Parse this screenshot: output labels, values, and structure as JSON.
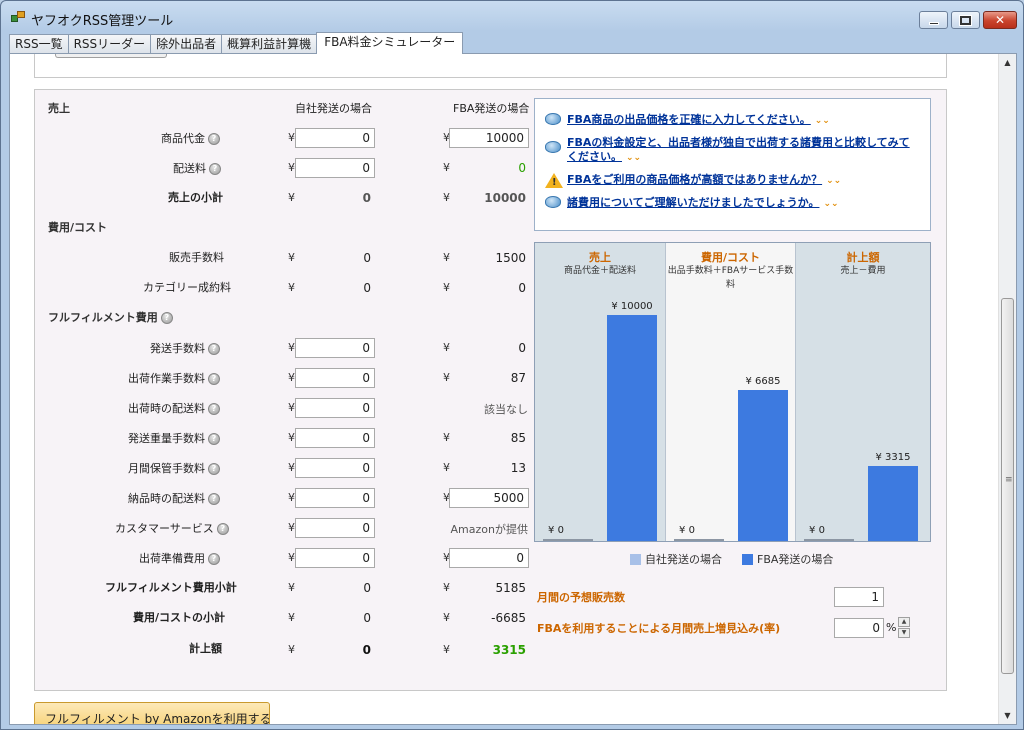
{
  "window": {
    "title": "ヤフオクRSS管理ツール"
  },
  "tabs": [
    {
      "label": "RSS一覧"
    },
    {
      "label": "RSSリーダー"
    },
    {
      "label": "除外出品者"
    },
    {
      "label": "概算利益計算機"
    },
    {
      "label": "FBA料金シミュレーター",
      "active": true
    }
  ],
  "headers": {
    "self": "自社発送の場合",
    "fba": "FBA発送の場合"
  },
  "sections": {
    "sales": "売上",
    "costs": "費用/コスト",
    "fulfillment": "フルフィルメント費用"
  },
  "currency": "¥",
  "rows": {
    "item_price": {
      "label": "商品代金",
      "self": "0",
      "fba": "10000"
    },
    "shipping": {
      "label": "配送料",
      "self": "0",
      "fba": "0"
    },
    "sales_subtotal": {
      "label": "売上の小計",
      "self": "0",
      "fba": "10000"
    },
    "sales_fee": {
      "label": "販売手数料",
      "self": "0",
      "fba": "1500"
    },
    "category_fee": {
      "label": "カテゴリー成約料",
      "self": "0",
      "fba": "0"
    },
    "ship_fee": {
      "label": "発送手数料",
      "self": "0",
      "fba": "0"
    },
    "handling_fee": {
      "label": "出荷作業手数料",
      "self": "0",
      "fba": "87"
    },
    "outbound_shipping": {
      "label": "出荷時の配送料",
      "self": "0",
      "fba": "該当なし"
    },
    "weight_fee": {
      "label": "発送重量手数料",
      "self": "0",
      "fba": "85"
    },
    "storage_fee": {
      "label": "月間保管手数料",
      "self": "0",
      "fba": "13"
    },
    "inbound_shipping": {
      "label": "納品時の配送料",
      "self": "0",
      "fba": "5000"
    },
    "customer_service": {
      "label": "カスタマーサービス",
      "self": "0",
      "fba": "Amazonが提供"
    },
    "prep_cost": {
      "label": "出荷準備費用",
      "self": "0",
      "fba": "0"
    },
    "fulfillment_subtotal": {
      "label": "フルフィルメント費用小計",
      "self": "0",
      "fba": "5185"
    },
    "cost_subtotal": {
      "label": "費用/コストの小計",
      "self": "0",
      "fba": "-6685"
    },
    "total": {
      "label": "計上額",
      "self": "0",
      "fba": "3315"
    }
  },
  "tips": [
    {
      "icon": "speech-bubble-icon",
      "text": "FBA商品の出品価格を正確に入力してください。"
    },
    {
      "icon": "speech-bubble-icon",
      "text": "FBAの料金設定と、出品者様が独自で出荷する諸費用と比較してみてください。"
    },
    {
      "icon": "warning-icon",
      "text": "FBAをご利用の商品価格が高額ではありませんか？"
    },
    {
      "icon": "speech-bubble-icon",
      "text": "諸費用についてご理解いただけましたでしょうか。"
    }
  ],
  "chart_data": {
    "type": "bar",
    "categories": [
      "売上",
      "費用/コスト",
      "計上額"
    ],
    "category_subtitles": [
      "商品代金＋配送料",
      "出品手数料＋FBAサービス手数料",
      "売上－費用"
    ],
    "series": [
      {
        "name": "自社発送の場合",
        "values": [
          0,
          0,
          0
        ],
        "labels": [
          "¥ 0",
          "¥ 0",
          "¥ 0"
        ],
        "color": "#8c96a3"
      },
      {
        "name": "FBA発送の場合",
        "values": [
          10000,
          6685,
          3315
        ],
        "labels": [
          "¥ 10000",
          "¥ 6685",
          "¥ 3315"
        ],
        "color": "#3d7ae0"
      }
    ],
    "ylim": [
      0,
      10000
    ],
    "legend": "bottom",
    "column_backgrounds": [
      "#d6e0e6",
      "#f6f6f6",
      "#d6e0e6"
    ]
  },
  "legend": {
    "self": "自社発送の場合",
    "fba": "FBA発送の場合",
    "self_color": "#a8c0e8",
    "fba_color": "#3d7ae0"
  },
  "forecast": {
    "monthly_sales_label": "月間の予想販売数",
    "monthly_sales_value": "1",
    "increase_label": "FBAを利用することによる月間売上増見込み(率)",
    "increase_value": "0",
    "increase_unit": "%"
  },
  "bottom_button": {
    "label": "フルフィルメント by Amazonを利用する"
  },
  "colors": {
    "accent_orange": "#cc6600",
    "link_blue": "#003399",
    "positive_green": "#2aa000"
  }
}
